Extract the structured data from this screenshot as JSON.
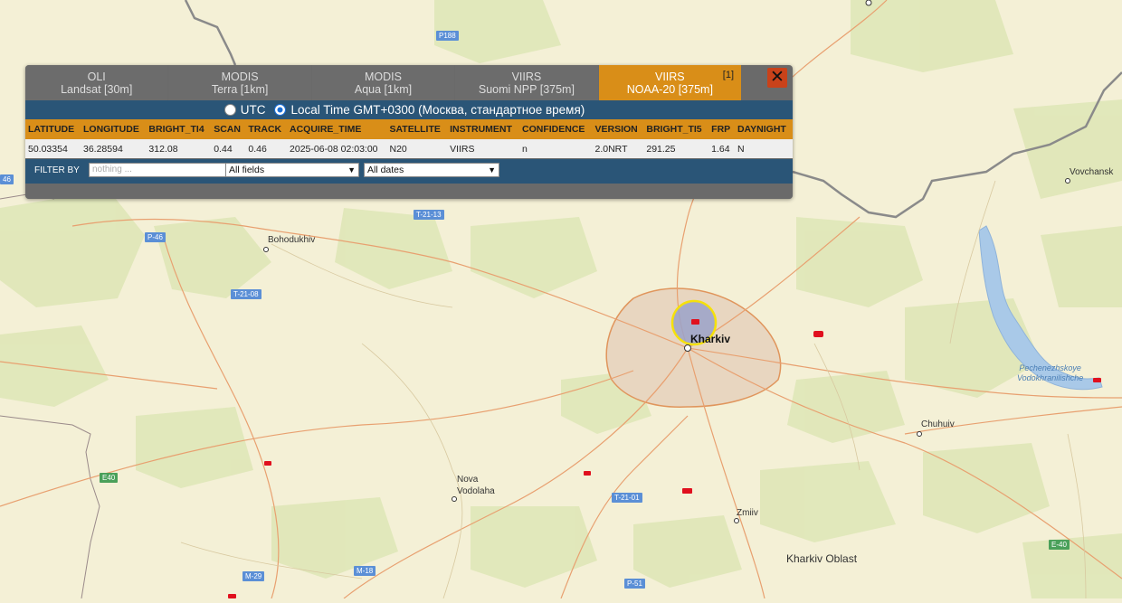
{
  "map": {
    "places": {
      "bohodukhiv": "Bohodukhiv",
      "kharkiv": "Kharkiv",
      "vovchansk": "Vovchansk",
      "chuhuiv": "Chuhuiv",
      "nova_vodolaha": "Nova\nVodolaha",
      "zmiiv": "Zmiiv",
      "oblast": "Kharkiv Oblast",
      "reservoir": "Pechenezhskoye\nVodokhranilishche"
    },
    "roads": [
      "P188",
      "P-46",
      "T-21-13",
      "T-21-08",
      "E40",
      "T-21-01",
      "M-29",
      "M-18",
      "P-51",
      "E-40",
      "46"
    ]
  },
  "panel": {
    "tabs": [
      {
        "line1": "OLI",
        "line2": "Landsat [30m]"
      },
      {
        "line1": "MODIS",
        "line2": "Terra [1km]"
      },
      {
        "line1": "MODIS",
        "line2": "Aqua [1km]"
      },
      {
        "line1": "VIIRS",
        "line2": "Suomi NPP [375m]"
      },
      {
        "line1": "VIIRS",
        "line2": "NOAA-20 [375m]",
        "count": "[1]"
      }
    ],
    "close_label": "✕",
    "time": {
      "utc_label": "UTC",
      "local_label": "Local Time GMT+0300 (Москва, стандартное время)"
    },
    "table": {
      "headers": [
        "LATITUDE",
        "LONGITUDE",
        "BRIGHT_TI4",
        "SCAN",
        "TRACK",
        "ACQUIRE_TIME",
        "SATELLITE",
        "INSTRUMENT",
        "CONFIDENCE",
        "VERSION",
        "BRIGHT_TI5",
        "FRP",
        "DAYNIGHT"
      ],
      "rows": [
        [
          "50.03354",
          "36.28594",
          "312.08",
          "0.44",
          "0.46",
          "2025-06-08 02:03:00",
          "N20",
          "VIIRS",
          "n",
          "2.0NRT",
          "291.25",
          "1.64",
          "N"
        ]
      ]
    },
    "filter": {
      "label": "FILTER BY",
      "placeholder": "nothing ...",
      "fields_value": "All fields",
      "dates_value": "All dates"
    }
  },
  "colors": {
    "tab_active": "#d98e18",
    "header_bar": "#2a5577",
    "fire_marker": "#e0101e",
    "highlight_ring": "#f5e10a"
  }
}
